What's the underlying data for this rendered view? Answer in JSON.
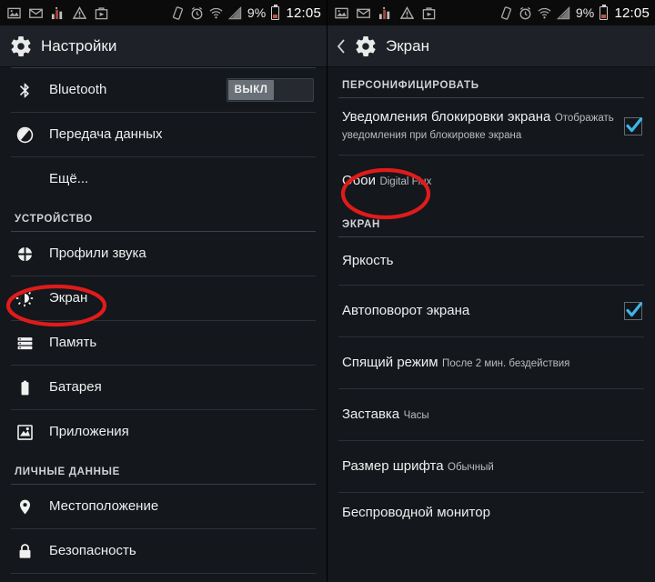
{
  "statusbar": {
    "icons": [
      "image-icon",
      "email-icon",
      "stats-icon",
      "warning-icon",
      "briefcase-icon"
    ],
    "right_icons": [
      "vibrate-icon",
      "alarm-icon",
      "wifi-icon",
      "signal-icon"
    ],
    "battery_percent": "9%",
    "clock": "12:05"
  },
  "left_panel": {
    "title": "Настройки",
    "title_icon": "gear-icon",
    "items": [
      {
        "label": "Bluetooth",
        "icon": "bluetooth-icon",
        "toggle": "ВЫКЛ"
      },
      {
        "label": "Передача данных",
        "icon": "data-usage-icon"
      },
      {
        "label": "Ещё...",
        "icon": null
      },
      {
        "section": "УСТРОЙСТВО"
      },
      {
        "label": "Профили звука",
        "icon": "sound-profile-icon"
      },
      {
        "label": "Экран",
        "icon": "display-icon",
        "highlighted": true
      },
      {
        "label": "Память",
        "icon": "storage-icon"
      },
      {
        "label": "Батарея",
        "icon": "battery-icon"
      },
      {
        "label": "Приложения",
        "icon": "apps-icon"
      },
      {
        "section": "ЛИЧНЫЕ ДАННЫЕ"
      },
      {
        "label": "Местоположение",
        "icon": "location-pin-icon"
      },
      {
        "label": "Безопасность",
        "icon": "lock-icon"
      }
    ]
  },
  "right_panel": {
    "title": "Экран",
    "title_icon": "gear-icon",
    "back_icon": "chevron-left-icon",
    "sections": [
      {
        "section": "ПЕРСОНИФИЦИРОВАТЬ"
      },
      {
        "label": "Уведомления блокировки экрана",
        "sub": "Отображать уведомления при блокировке экрана",
        "checked": true
      },
      {
        "label": "Обои",
        "sub": "Digital Flux",
        "highlighted": true
      },
      {
        "section": "ЭКРАН"
      },
      {
        "label": "Яркость"
      },
      {
        "label": "Автоповорот экрана",
        "checked": true
      },
      {
        "label": "Спящий режим",
        "sub": "После 2 мин. бездействия"
      },
      {
        "label": "Заставка",
        "sub": "Часы"
      },
      {
        "label": "Размер шрифта",
        "sub": "Обычный"
      },
      {
        "label": "Беспроводной монитор"
      }
    ]
  },
  "colors": {
    "annotation": "#e01b1b",
    "checkbox_check": "#3fb4e8",
    "background": "#14171c",
    "actionbar": "#1e2228",
    "statusbar": "#0b0b0b"
  }
}
